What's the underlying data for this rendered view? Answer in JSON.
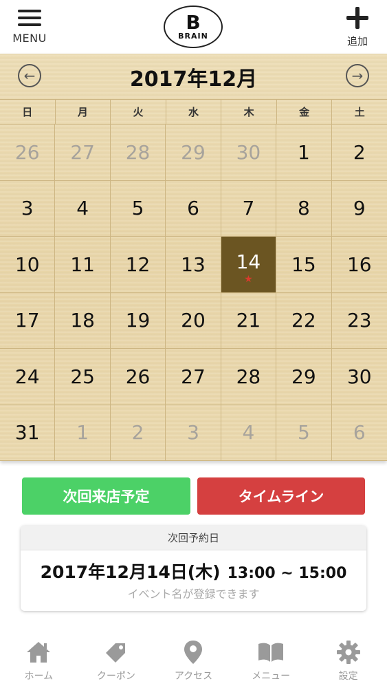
{
  "header": {
    "menu_label": "MENU",
    "logo_mark": "B",
    "logo_text": "BRAIN",
    "add_label": "追加"
  },
  "calendar": {
    "title": "2017年12月",
    "prev_arrow": "←",
    "next_arrow": "→",
    "weekdays": [
      "日",
      "月",
      "火",
      "水",
      "木",
      "金",
      "土"
    ],
    "days": [
      {
        "n": "26",
        "muted": true
      },
      {
        "n": "27",
        "muted": true
      },
      {
        "n": "28",
        "muted": true
      },
      {
        "n": "29",
        "muted": true
      },
      {
        "n": "30",
        "muted": true
      },
      {
        "n": "1"
      },
      {
        "n": "2"
      },
      {
        "n": "3"
      },
      {
        "n": "4"
      },
      {
        "n": "5"
      },
      {
        "n": "6"
      },
      {
        "n": "7"
      },
      {
        "n": "8"
      },
      {
        "n": "9"
      },
      {
        "n": "10"
      },
      {
        "n": "11"
      },
      {
        "n": "12"
      },
      {
        "n": "13"
      },
      {
        "n": "14",
        "today": true,
        "star": "★"
      },
      {
        "n": "15"
      },
      {
        "n": "16"
      },
      {
        "n": "17"
      },
      {
        "n": "18"
      },
      {
        "n": "19"
      },
      {
        "n": "20"
      },
      {
        "n": "21"
      },
      {
        "n": "22"
      },
      {
        "n": "23"
      },
      {
        "n": "24"
      },
      {
        "n": "25"
      },
      {
        "n": "26"
      },
      {
        "n": "27"
      },
      {
        "n": "28"
      },
      {
        "n": "29"
      },
      {
        "n": "30"
      },
      {
        "n": "31"
      },
      {
        "n": "1",
        "muted": true
      },
      {
        "n": "2",
        "muted": true
      },
      {
        "n": "3",
        "muted": true
      },
      {
        "n": "4",
        "muted": true
      },
      {
        "n": "5",
        "muted": true
      },
      {
        "n": "6",
        "muted": true
      }
    ]
  },
  "actions": {
    "next_visit_label": "次回来店予定",
    "timeline_label": "タイムライン"
  },
  "reservation": {
    "heading": "次回予約日",
    "date": "2017年12月14日(木)",
    "time": "13:00 ~ 15:00",
    "note": "イベント名が登録できます"
  },
  "bottom_nav": {
    "items": [
      {
        "label": "ホーム",
        "icon": "home-icon"
      },
      {
        "label": "クーポン",
        "icon": "tag-icon"
      },
      {
        "label": "アクセス",
        "icon": "map-pin-icon"
      },
      {
        "label": "メニュー",
        "icon": "book-icon"
      },
      {
        "label": "設定",
        "icon": "gear-icon"
      }
    ]
  },
  "colors": {
    "today_bg": "#6b5522",
    "star": "#d93a2d",
    "next_visit_btn": "#4cd167",
    "timeline_btn": "#d54040",
    "nav_icon": "#9a9a9a"
  }
}
